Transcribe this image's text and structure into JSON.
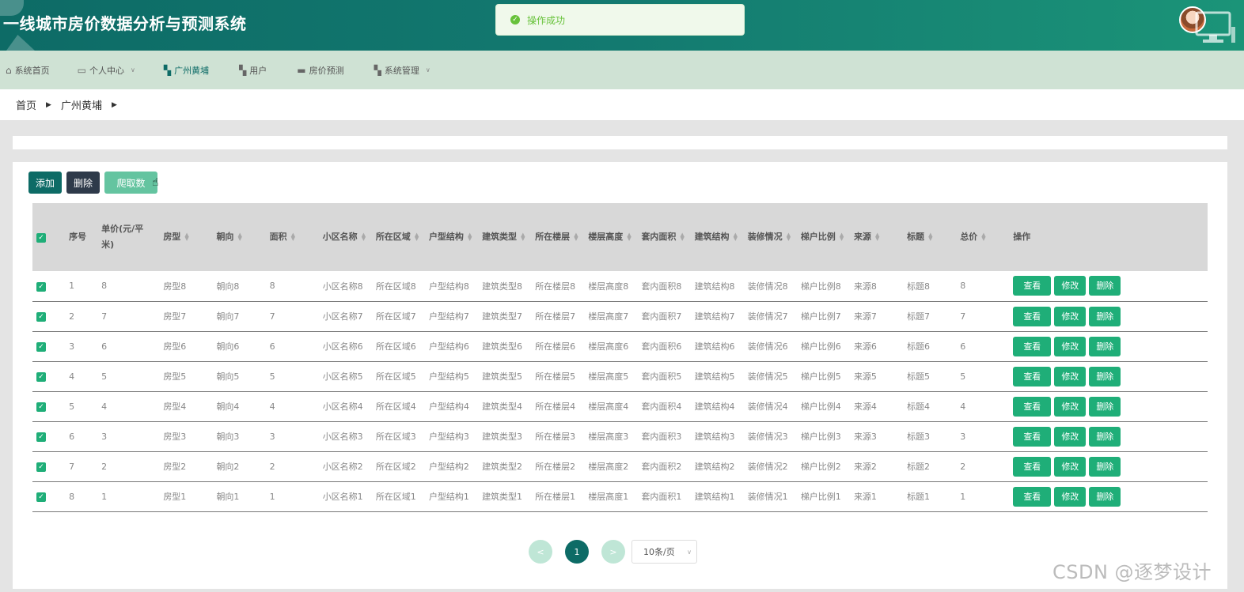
{
  "app": {
    "title": "一线城市房价数据分析与预测系统"
  },
  "toast": {
    "message": "操作成功"
  },
  "nav": [
    {
      "label": "系统首页",
      "icon": "home-icon",
      "active": false,
      "caret": false
    },
    {
      "label": "个人中心",
      "icon": "id-card-icon",
      "active": false,
      "caret": true
    },
    {
      "label": "广州黄埔",
      "icon": "grid-icon",
      "active": true,
      "caret": false
    },
    {
      "label": "用户",
      "icon": "grid-icon",
      "active": false,
      "caret": false
    },
    {
      "label": "房价预测",
      "icon": "ticket-icon",
      "active": false,
      "caret": false
    },
    {
      "label": "系统管理",
      "icon": "grid-icon",
      "active": false,
      "caret": true
    }
  ],
  "breadcrumb": {
    "home": "首页",
    "current": "广州黄埔"
  },
  "toolbar": {
    "add_label": "添加",
    "delete_label": "删除",
    "crawl_label": "爬取数"
  },
  "table": {
    "columns": [
      "序号",
      "单价(元/平米)",
      "房型",
      "朝向",
      "面积",
      "小区名称",
      "所在区域",
      "户型结构",
      "建筑类型",
      "所在楼层",
      "楼层高度",
      "套内面积",
      "建筑结构",
      "装修情况",
      "梯户比例",
      "来源",
      "标题",
      "总价",
      "操作"
    ],
    "rows": [
      [
        "1",
        "8",
        "房型8",
        "朝向8",
        "8",
        "小区名称8",
        "所在区域8",
        "户型结构8",
        "建筑类型8",
        "所在楼层8",
        "楼层高度8",
        "套内面积8",
        "建筑结构8",
        "装修情况8",
        "梯户比例8",
        "来源8",
        "标题8",
        "8"
      ],
      [
        "2",
        "7",
        "房型7",
        "朝向7",
        "7",
        "小区名称7",
        "所在区域7",
        "户型结构7",
        "建筑类型7",
        "所在楼层7",
        "楼层高度7",
        "套内面积7",
        "建筑结构7",
        "装修情况7",
        "梯户比例7",
        "来源7",
        "标题7",
        "7"
      ],
      [
        "3",
        "6",
        "房型6",
        "朝向6",
        "6",
        "小区名称6",
        "所在区域6",
        "户型结构6",
        "建筑类型6",
        "所在楼层6",
        "楼层高度6",
        "套内面积6",
        "建筑结构6",
        "装修情况6",
        "梯户比例6",
        "来源6",
        "标题6",
        "6"
      ],
      [
        "4",
        "5",
        "房型5",
        "朝向5",
        "5",
        "小区名称5",
        "所在区域5",
        "户型结构5",
        "建筑类型5",
        "所在楼层5",
        "楼层高度5",
        "套内面积5",
        "建筑结构5",
        "装修情况5",
        "梯户比例5",
        "来源5",
        "标题5",
        "5"
      ],
      [
        "5",
        "4",
        "房型4",
        "朝向4",
        "4",
        "小区名称4",
        "所在区域4",
        "户型结构4",
        "建筑类型4",
        "所在楼层4",
        "楼层高度4",
        "套内面积4",
        "建筑结构4",
        "装修情况4",
        "梯户比例4",
        "来源4",
        "标题4",
        "4"
      ],
      [
        "6",
        "3",
        "房型3",
        "朝向3",
        "3",
        "小区名称3",
        "所在区域3",
        "户型结构3",
        "建筑类型3",
        "所在楼层3",
        "楼层高度3",
        "套内面积3",
        "建筑结构3",
        "装修情况3",
        "梯户比例3",
        "来源3",
        "标题3",
        "3"
      ],
      [
        "7",
        "2",
        "房型2",
        "朝向2",
        "2",
        "小区名称2",
        "所在区域2",
        "户型结构2",
        "建筑类型2",
        "所在楼层2",
        "楼层高度2",
        "套内面积2",
        "建筑结构2",
        "装修情况2",
        "梯户比例2",
        "来源2",
        "标题2",
        "2"
      ],
      [
        "8",
        "1",
        "房型1",
        "朝向1",
        "1",
        "小区名称1",
        "所在区域1",
        "户型结构1",
        "建筑类型1",
        "所在楼层1",
        "楼层高度1",
        "套内面积1",
        "建筑结构1",
        "装修情况1",
        "梯户比例1",
        "来源1",
        "标题1",
        "1"
      ]
    ],
    "actions": {
      "view": "查看",
      "edit": "修改",
      "delete": "删除"
    }
  },
  "pagination": {
    "prev": "<",
    "current": "1",
    "next": ">",
    "page_size": "10条/页"
  },
  "watermark": "CSDN @逐梦设计",
  "colors": {
    "header": "#0d6b66",
    "nav_bg": "#cfe2d4",
    "action_green": "#1fae78",
    "dark_button": "#2e3a4a",
    "toast_bg": "#f0f9eb"
  }
}
